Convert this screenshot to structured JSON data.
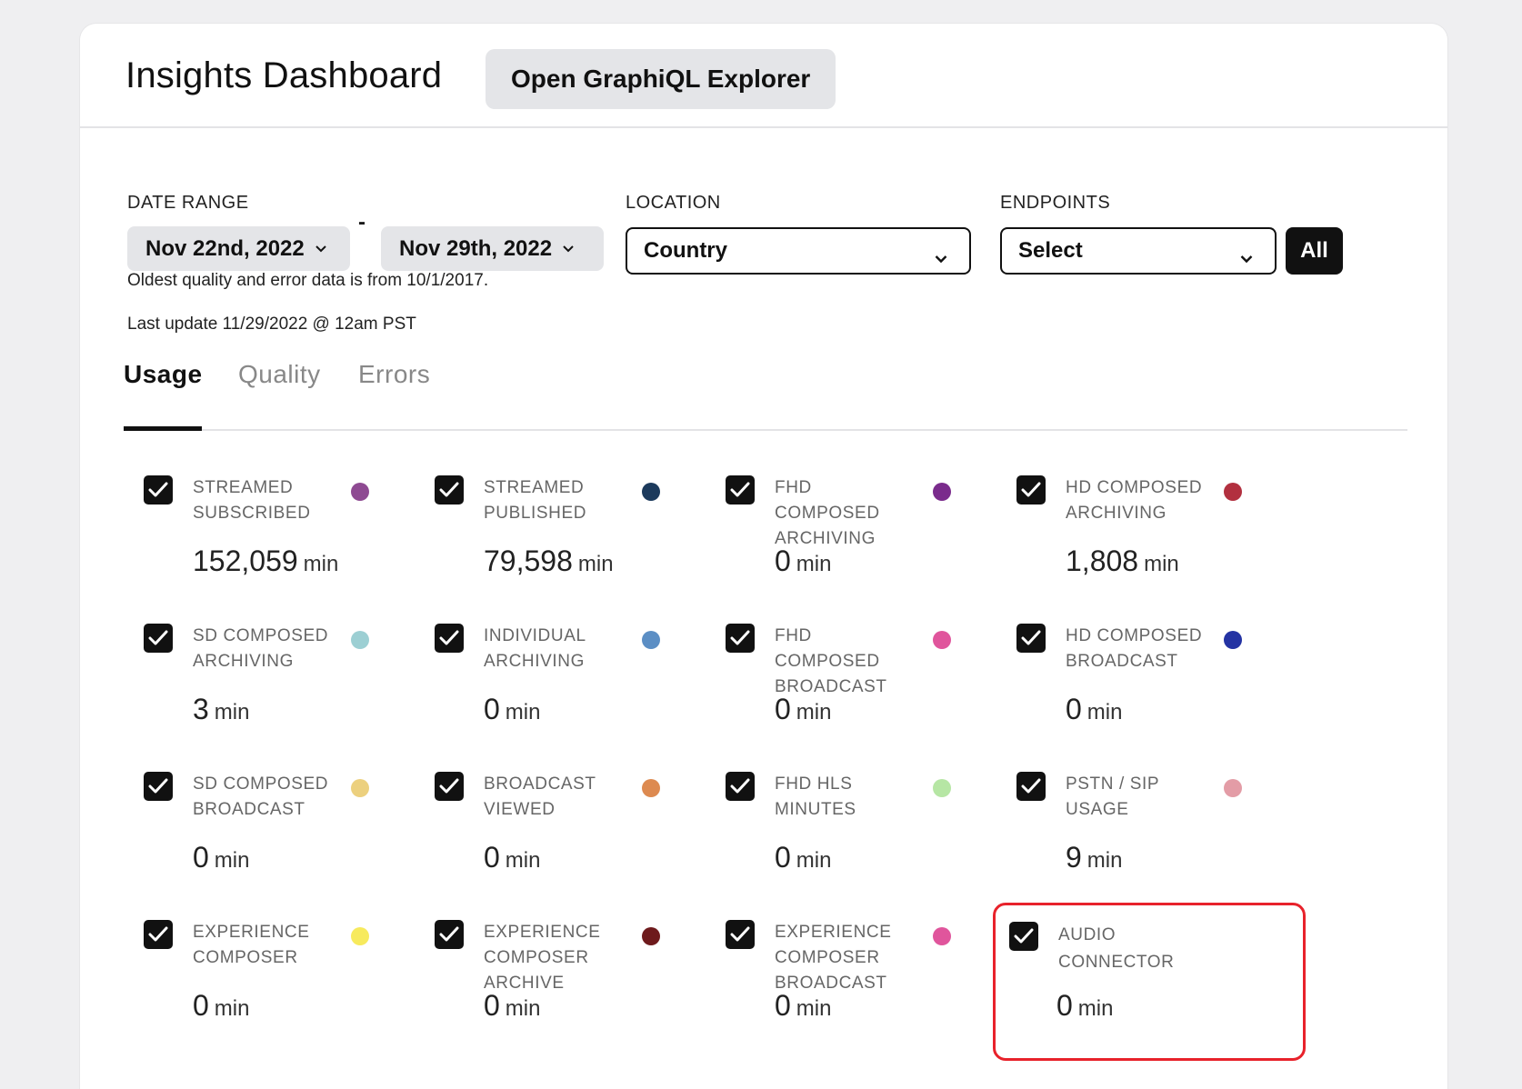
{
  "header": {
    "title": "Insights Dashboard",
    "explorer_button": "Open GraphiQL Explorer"
  },
  "filters": {
    "date_range_label": "DATE RANGE",
    "date_start": "Nov 22nd, 2022",
    "date_separator": "-",
    "date_end": "Nov 29th, 2022",
    "location_label": "LOCATION",
    "location_value": "Country",
    "endpoints_label": "ENDPOINTS",
    "endpoints_value": "Select",
    "all_button": "All"
  },
  "notes": {
    "oldest": "Oldest quality and error data is from 10/1/2017.",
    "last_update": "Last update 11/29/2022 @ 12am PST"
  },
  "tabs": [
    {
      "label": "Usage",
      "active": true
    },
    {
      "label": "Quality",
      "active": false
    },
    {
      "label": "Errors",
      "active": false
    }
  ],
  "metrics": [
    {
      "line1": "STREAMED",
      "line2": "SUBSCRIBED",
      "line3": "",
      "value": "152,059",
      "unit": "min",
      "color": "#8e4a92",
      "checked": true
    },
    {
      "line1": "STREAMED",
      "line2": "PUBLISHED",
      "line3": "",
      "value": "79,598",
      "unit": "min",
      "color": "#1c3a5c",
      "checked": true
    },
    {
      "line1": "FHD COMPOSED",
      "line2": "ARCHIVING",
      "line3": "",
      "value": "0",
      "unit": "min",
      "color": "#7a2b8c",
      "checked": true
    },
    {
      "line1": "HD COMPOSED",
      "line2": "ARCHIVING",
      "line3": "",
      "value": "1,808",
      "unit": "min",
      "color": "#b2303f",
      "checked": true
    },
    {
      "line1": "SD COMPOSED",
      "line2": "ARCHIVING",
      "line3": "",
      "value": "3",
      "unit": "min",
      "color": "#9ccfd3",
      "checked": true
    },
    {
      "line1": "INDIVIDUAL",
      "line2": "ARCHIVING",
      "line3": "",
      "value": "0",
      "unit": "min",
      "color": "#5b8ec4",
      "checked": true
    },
    {
      "line1": "FHD COMPOSED",
      "line2": "BROADCAST",
      "line3": "",
      "value": "0",
      "unit": "min",
      "color": "#e0559c",
      "checked": true
    },
    {
      "line1": "HD COMPOSED",
      "line2": "BROADCAST",
      "line3": "",
      "value": "0",
      "unit": "min",
      "color": "#2433a3",
      "checked": true
    },
    {
      "line1": "SD COMPOSED",
      "line2": "BROADCAST",
      "line3": "",
      "value": "0",
      "unit": "min",
      "color": "#ecd07e",
      "checked": true
    },
    {
      "line1": "BROADCAST",
      "line2": "VIEWED",
      "line3": "",
      "value": "0",
      "unit": "min",
      "color": "#dd8a50",
      "checked": true
    },
    {
      "line1": "FHD HLS",
      "line2": "MINUTES",
      "line3": "",
      "value": "0",
      "unit": "min",
      "color": "#b6e6a4",
      "checked": true
    },
    {
      "line1": "PSTN / SIP",
      "line2": "USAGE",
      "line3": "",
      "value": "9",
      "unit": "min",
      "color": "#e39ca6",
      "checked": true
    },
    {
      "line1": "EXPERIENCE",
      "line2": "COMPOSER",
      "line3": "",
      "value": "0",
      "unit": "min",
      "color": "#f7ea5d",
      "checked": true
    },
    {
      "line1": "EXPERIENCE",
      "line2": "COMPOSER",
      "line3": "ARCHIVE",
      "value": "0",
      "unit": "min",
      "color": "#6e1a1c",
      "checked": true
    },
    {
      "line1": "EXPERIENCE",
      "line2": "COMPOSER",
      "line3": "BROADCAST",
      "value": "0",
      "unit": "min",
      "color": "#e0559c",
      "checked": true
    },
    {
      "line1": "AUDIO",
      "line2": "CONNECTOR",
      "line3": "",
      "value": "0",
      "unit": "min",
      "color": "",
      "checked": true
    }
  ],
  "highlight_color": "#e8222b"
}
